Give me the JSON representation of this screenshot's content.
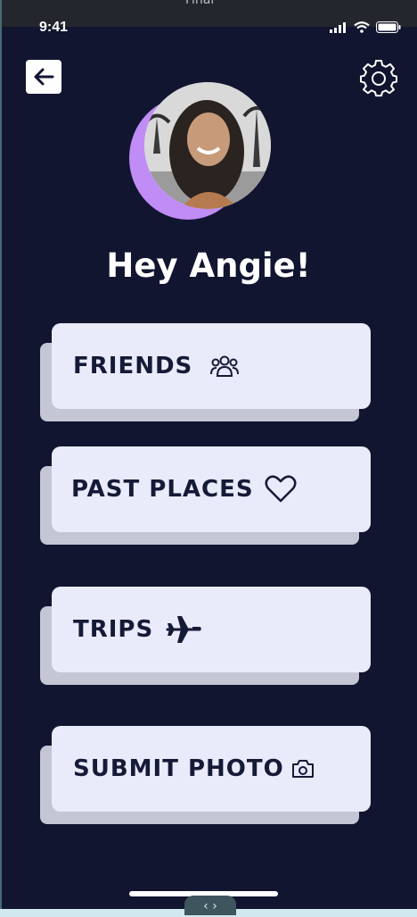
{
  "window": {
    "tab_label": "Final"
  },
  "status_bar": {
    "time": "9:41"
  },
  "header": {
    "back_icon": "back-arrow-icon",
    "settings_icon": "gear-icon"
  },
  "profile": {
    "greeting": "Hey Angie!"
  },
  "menu": [
    {
      "label": "FRIENDS",
      "icon": "people-group-icon"
    },
    {
      "label": "PAST PLACES",
      "icon": "heart-icon"
    },
    {
      "label": "TRIPS",
      "icon": "airplane-icon"
    },
    {
      "label": "SUBMIT PHOTO",
      "icon": "camera-icon"
    }
  ],
  "bottom_nav": {
    "label": "‹ ›"
  },
  "colors": {
    "background": "#111530",
    "card": "#e9ebfb",
    "card_shadow": "#c4c6d6",
    "accent": "#c08cf5",
    "text_dark": "#151a36"
  }
}
